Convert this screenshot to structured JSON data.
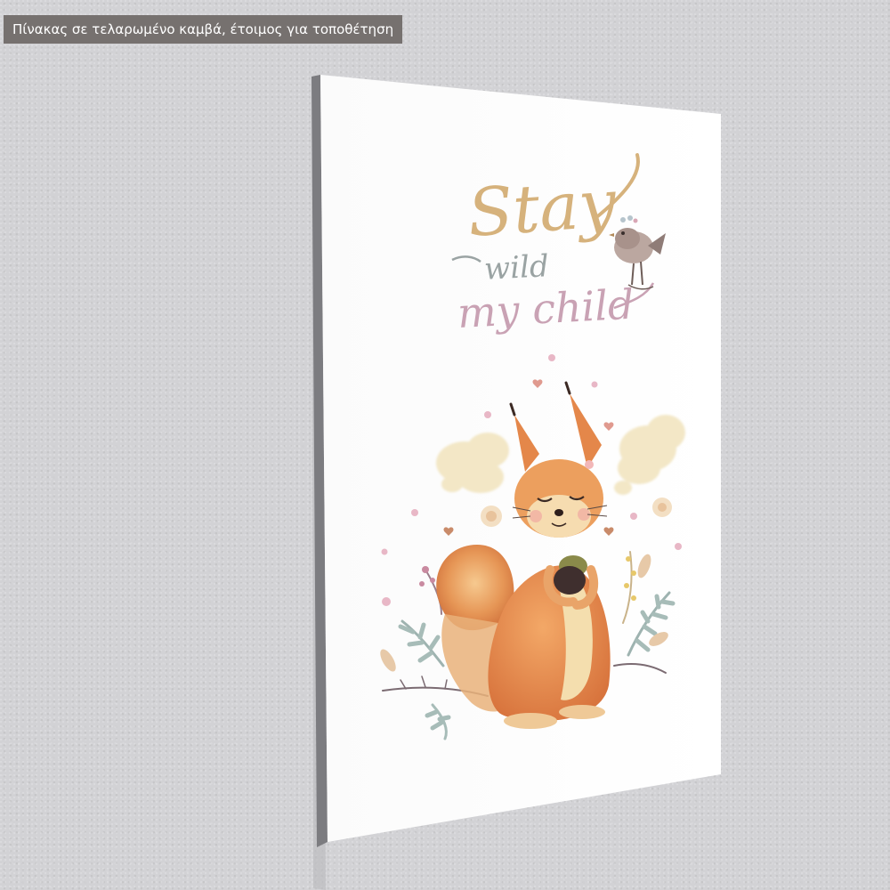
{
  "caption": {
    "text": "Πίνακας σε τελαρωμένο καμβά,  έτοιμος για τοποθέτηση"
  },
  "artwork": {
    "quote_line1": "Stay",
    "quote_line2": "wild",
    "quote_line3": "my child"
  },
  "colors": {
    "wall": "#d2d2d5",
    "caption_bg": "#76716f",
    "canvas_face": "#ffffff",
    "canvas_edge": "#7c7c80",
    "quote_gold": "#d6b27c",
    "quote_grey": "#9aa3a3",
    "quote_pink": "#c9a2b4",
    "squirrel_orange": "#e08a4f",
    "cloud_cream": "#f3e7c6"
  },
  "icons": {
    "squirrel": "squirrel-illustration",
    "bird": "bird-illustration"
  }
}
